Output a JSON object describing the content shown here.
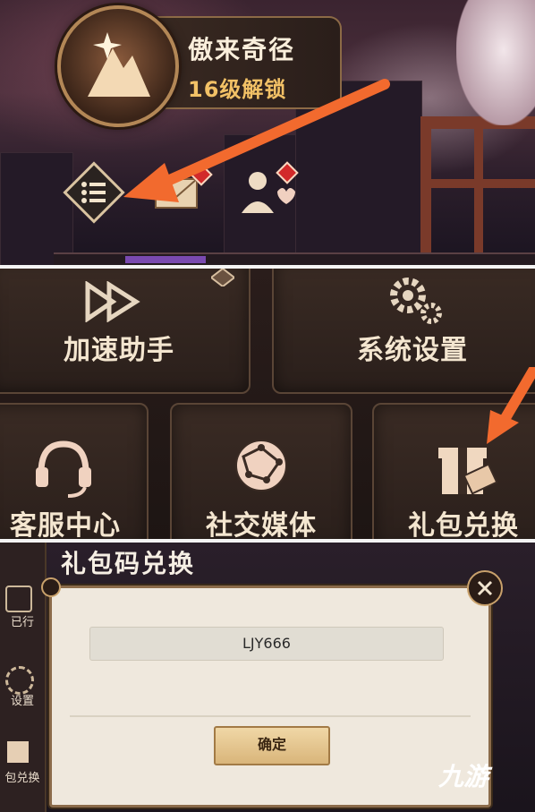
{
  "panel_top": {
    "achievement": {
      "title": "傲来奇径",
      "subtitle": "16级解锁",
      "icon": "mountain-star-icon"
    },
    "icons": [
      "menu-list-icon",
      "mail-envelope-icon",
      "friends-icon"
    ],
    "accent_red": "#d22a2a",
    "arrow_color": "#f26a2e"
  },
  "panel_menu": {
    "tiles": [
      {
        "label": "加速助手",
        "icon": "fast-forward-icon"
      },
      {
        "label": "系统设置",
        "icon": "gears-icon"
      },
      {
        "label": "客服中心",
        "icon": "headset-icon"
      },
      {
        "label": "社交媒体",
        "icon": "globe-network-icon"
      },
      {
        "label": "礼包兑换",
        "icon": "gift-ticket-icon"
      }
    ]
  },
  "panel_redeem": {
    "dialog_title": "礼包码兑换",
    "code_value": "LJY666",
    "confirm_label": "确定",
    "close_icon": "close-icon",
    "sidebar": [
      {
        "label": "已行"
      },
      {
        "label": "设置"
      },
      {
        "label": "包兑换"
      }
    ]
  },
  "watermark": {
    "text": "九游"
  }
}
